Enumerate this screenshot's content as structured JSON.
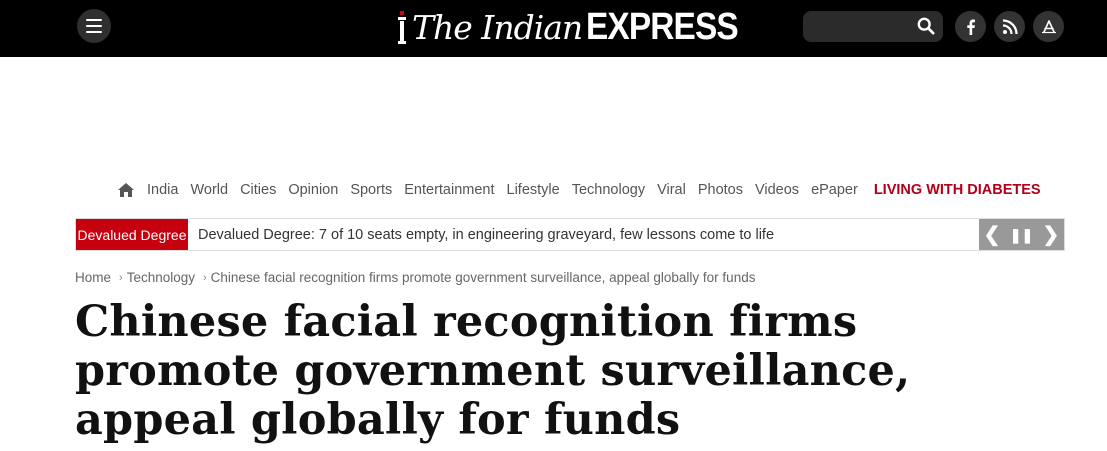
{
  "header": {
    "logo_the": "The Indian",
    "logo_express": "EXPRESS",
    "search_placeholder": "",
    "icons": [
      "menu-icon",
      "search-icon",
      "facebook-icon",
      "rss-icon",
      "app-store-icon"
    ]
  },
  "nav": {
    "items": [
      "India",
      "World",
      "Cities",
      "Opinion",
      "Sports",
      "Entertainment",
      "Lifestyle",
      "Technology",
      "Viral",
      "Photos",
      "Videos",
      "ePaper"
    ],
    "highlight": "LIVING WITH DIABETES"
  },
  "ticker": {
    "label": "Devalued Degree",
    "text": "Devalued Degree: 7 of 10 seats empty, in engineering graveyard, few lessons come to life",
    "prev": "❮",
    "pause": "❚❚",
    "next": "❯"
  },
  "breadcrumb": {
    "items": [
      "Home",
      "Technology",
      "Chinese facial recognition firms promote government surveillance, appeal globally for funds"
    ]
  },
  "article": {
    "headline": "Chinese facial recognition firms promote government surveillance, appeal globally for funds"
  },
  "colors": {
    "topbar": "#000000",
    "accent_red": "#c5000f",
    "highlight_red": "#b2001a"
  }
}
